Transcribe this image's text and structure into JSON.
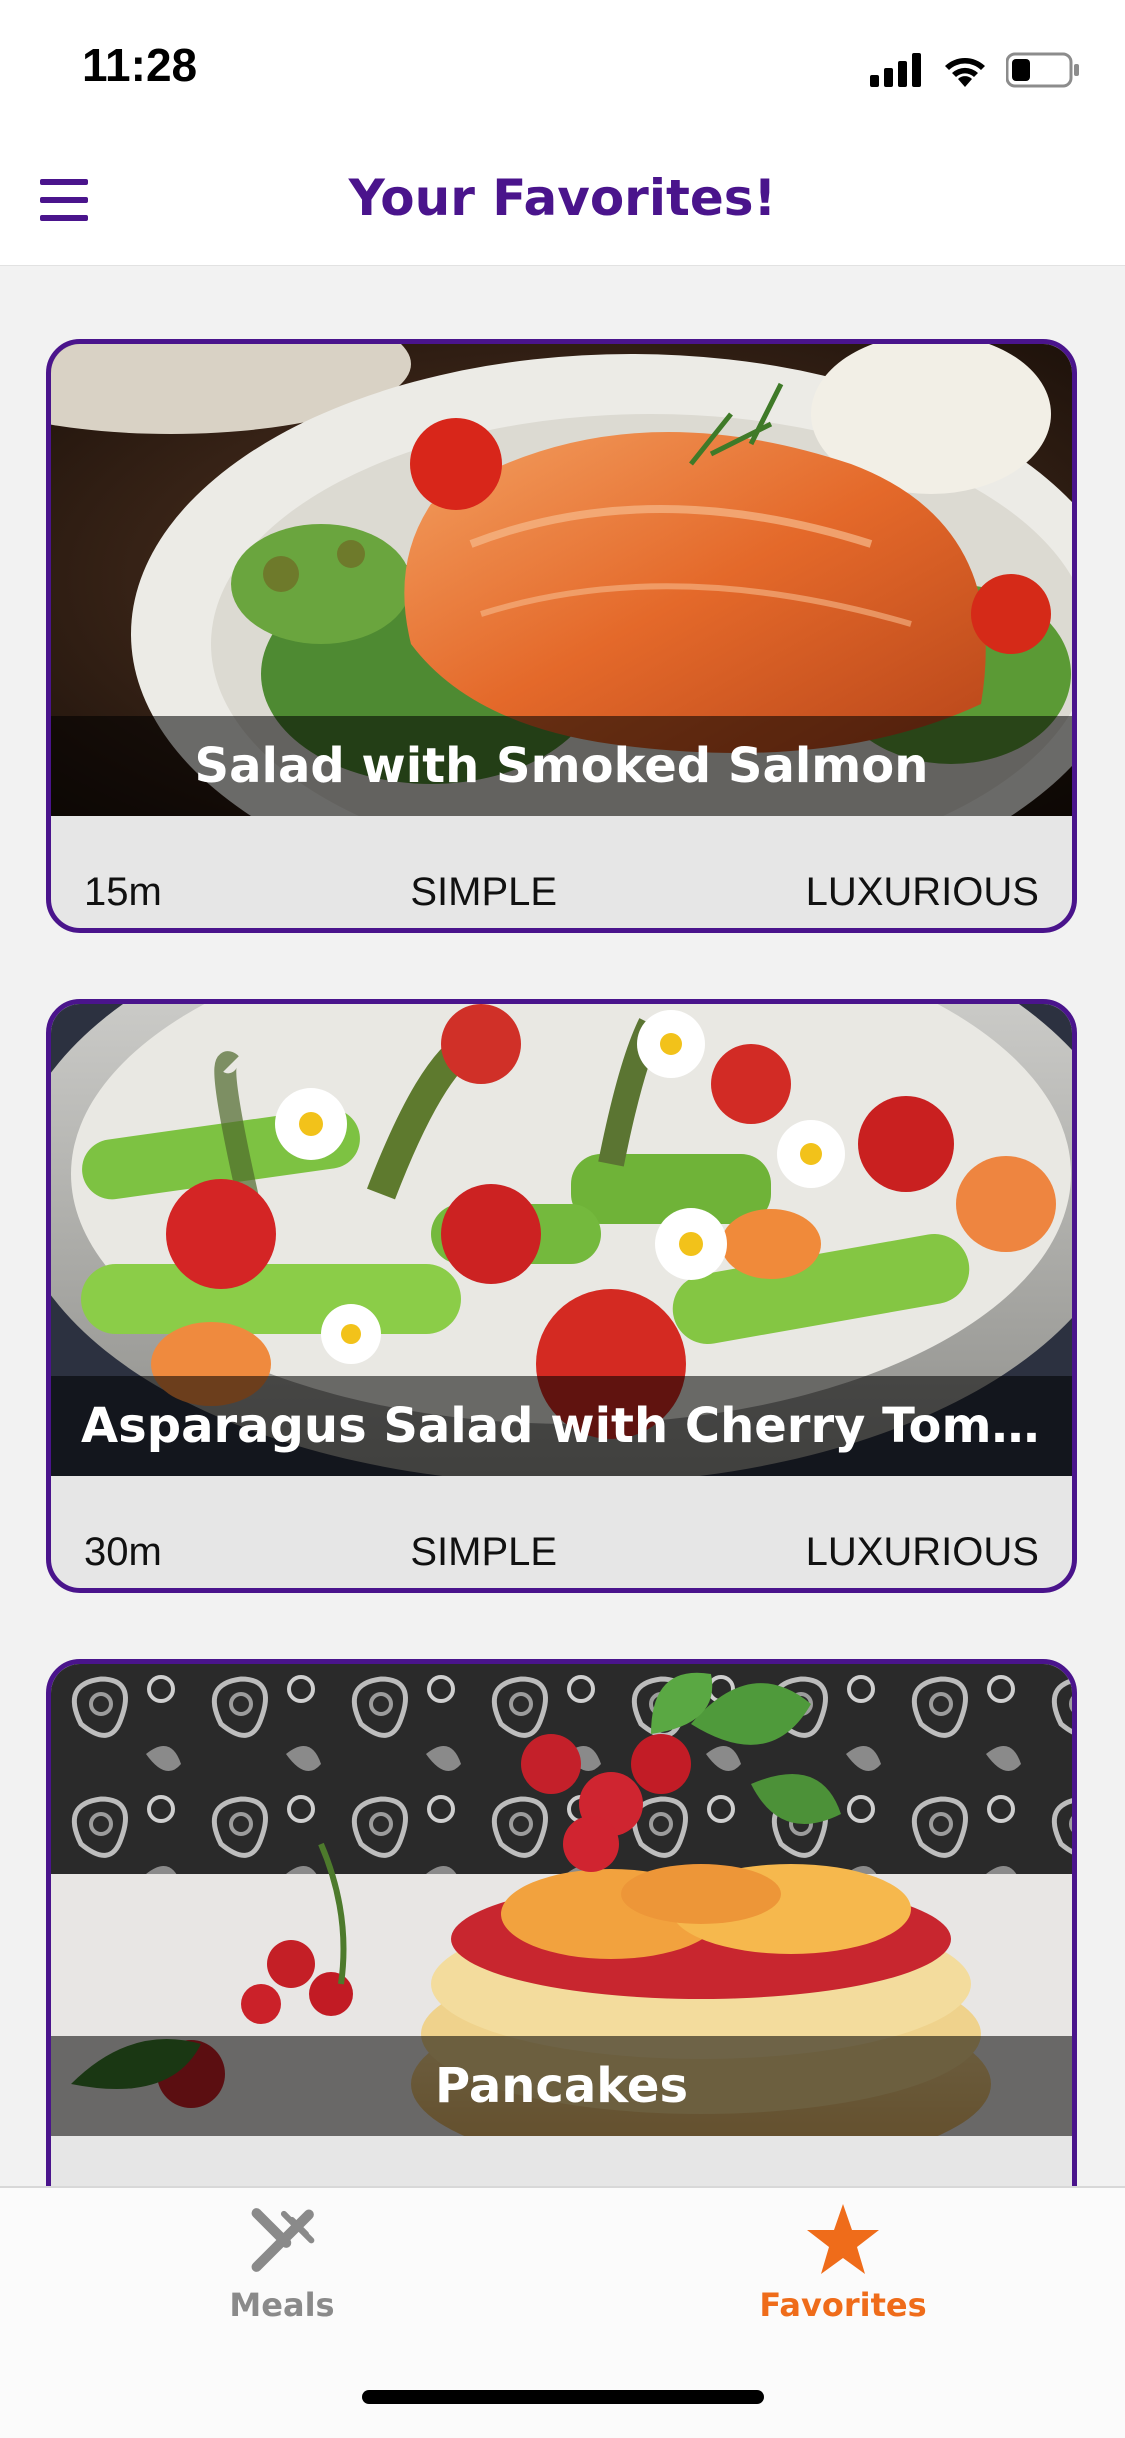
{
  "status_bar": {
    "time": "11:28"
  },
  "header": {
    "title": "Your Favorites!",
    "menu_icon": "hamburger-menu-icon",
    "accent_color": "#4a148c"
  },
  "meals": [
    {
      "title": "Salad with Smoked Salmon",
      "duration": "15m",
      "complexity": "SIMPLE",
      "affordability": "LUXURIOUS"
    },
    {
      "title": "Asparagus Salad with Cherry Tomat...",
      "duration": "30m",
      "complexity": "SIMPLE",
      "affordability": "LUXURIOUS"
    },
    {
      "title": "Pancakes",
      "duration": "",
      "complexity": "",
      "affordability": ""
    }
  ],
  "tabbar": {
    "tabs": [
      {
        "label": "Meals",
        "icon": "fork-knife-icon",
        "active": false,
        "color": "#8a8a8a"
      },
      {
        "label": "Favorites",
        "icon": "star-icon",
        "active": true,
        "color": "#ef6c1a"
      }
    ]
  }
}
